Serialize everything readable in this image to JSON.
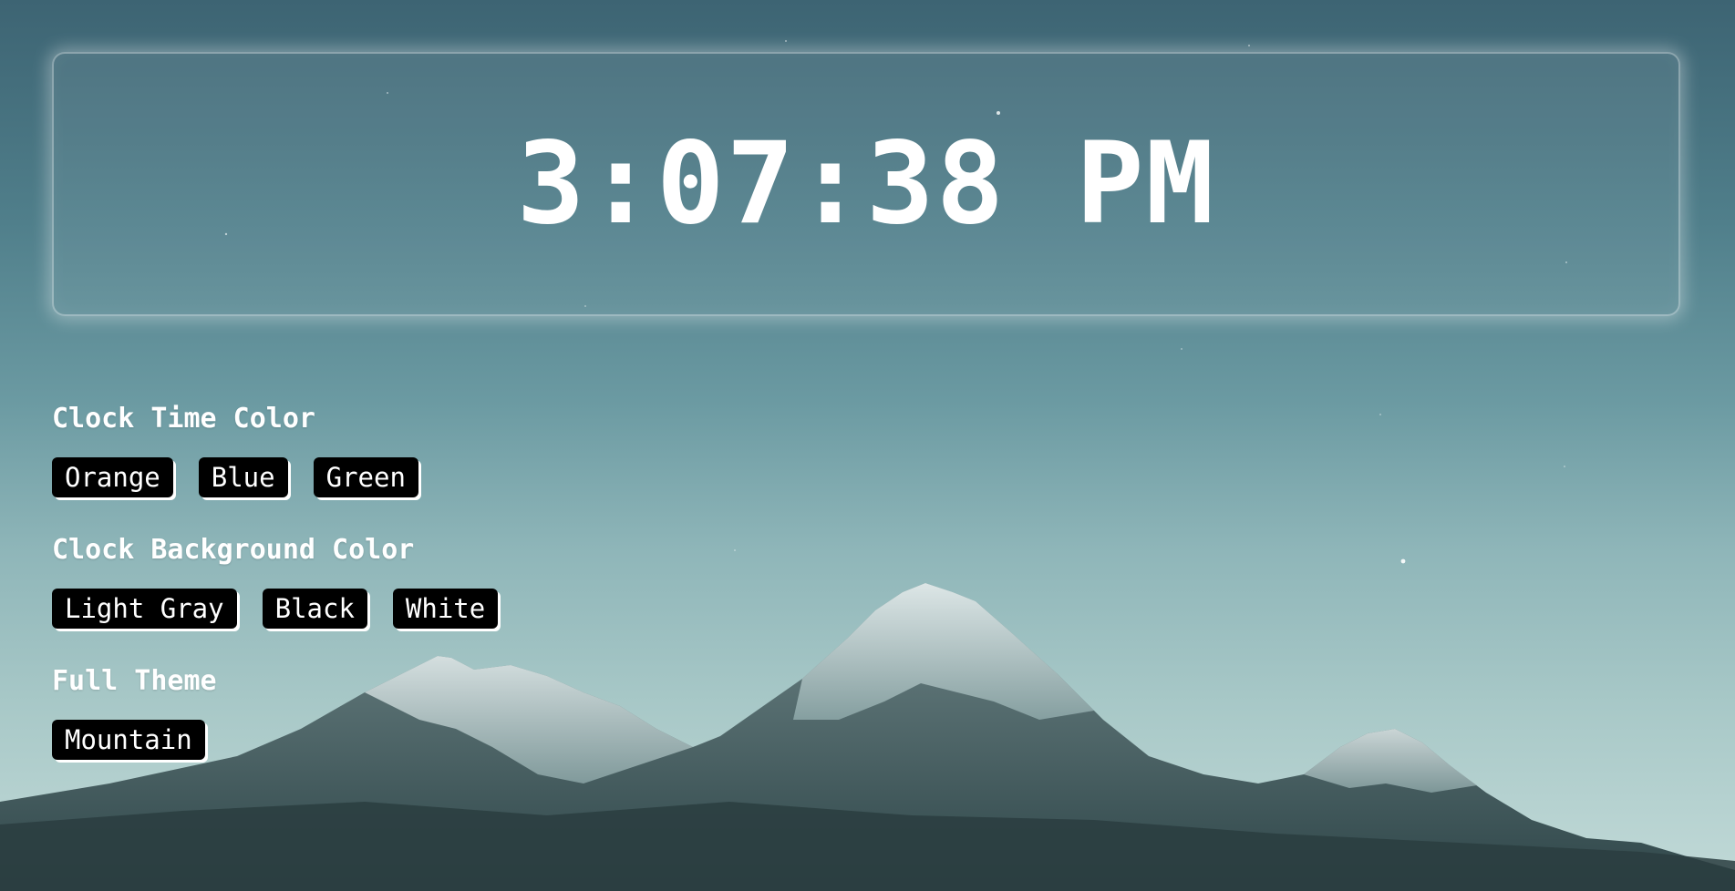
{
  "clock": {
    "time": "3:07:38 PM"
  },
  "sections": [
    {
      "title": "Clock Time Color",
      "buttons": [
        "Orange",
        "Blue",
        "Green"
      ]
    },
    {
      "title": "Clock Background Color",
      "buttons": [
        "Light Gray",
        "Black",
        "White"
      ]
    },
    {
      "title": "Full Theme",
      "buttons": [
        "Mountain"
      ]
    }
  ],
  "colors": {
    "button_bg": "#000000",
    "button_text": "#ffffff",
    "clock_text": "#ffffff",
    "sky_top": "#3d6473",
    "sky_bottom": "#c2dad8"
  }
}
